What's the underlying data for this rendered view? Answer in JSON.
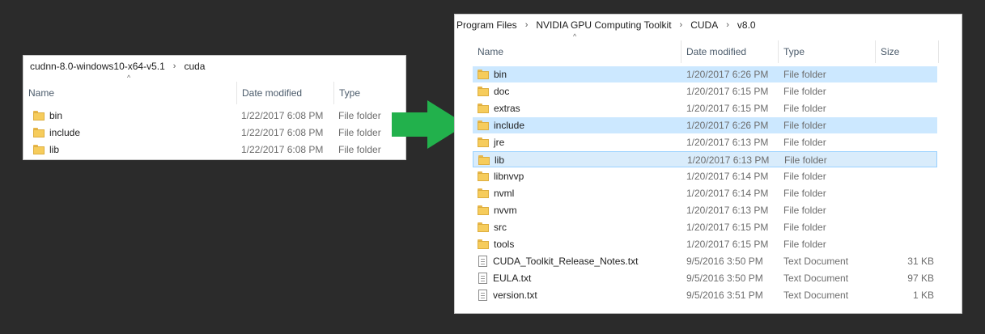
{
  "left_window": {
    "breadcrumb": [
      "cudnn-8.0-windows10-x64-v5.1",
      "cuda"
    ],
    "columns": {
      "name": "Name",
      "date": "Date modified",
      "type": "Type"
    },
    "rows": [
      {
        "name": "bin",
        "date": "1/22/2017 6:08 PM",
        "type": "File folder",
        "icon": "folder-icon"
      },
      {
        "name": "include",
        "date": "1/22/2017 6:08 PM",
        "type": "File folder",
        "icon": "folder-icon"
      },
      {
        "name": "lib",
        "date": "1/22/2017 6:08 PM",
        "type": "File folder",
        "icon": "folder-icon"
      }
    ]
  },
  "arrow": {
    "color": "#22b14c",
    "icon": "right-arrow-icon"
  },
  "right_window": {
    "breadcrumb": [
      "Program Files",
      "NVIDIA GPU Computing Toolkit",
      "CUDA",
      "v8.0"
    ],
    "columns": {
      "name": "Name",
      "date": "Date modified",
      "type": "Type",
      "size": "Size"
    },
    "rows": [
      {
        "name": "bin",
        "date": "1/20/2017 6:26 PM",
        "type": "File folder",
        "size": "",
        "icon": "folder-icon",
        "state": "selected"
      },
      {
        "name": "doc",
        "date": "1/20/2017 6:15 PM",
        "type": "File folder",
        "size": "",
        "icon": "folder-icon",
        "state": ""
      },
      {
        "name": "extras",
        "date": "1/20/2017 6:15 PM",
        "type": "File folder",
        "size": "",
        "icon": "folder-icon",
        "state": ""
      },
      {
        "name": "include",
        "date": "1/20/2017 6:26 PM",
        "type": "File folder",
        "size": "",
        "icon": "folder-icon",
        "state": "selected"
      },
      {
        "name": "jre",
        "date": "1/20/2017 6:13 PM",
        "type": "File folder",
        "size": "",
        "icon": "folder-icon",
        "state": ""
      },
      {
        "name": "lib",
        "date": "1/20/2017 6:13 PM",
        "type": "File folder",
        "size": "",
        "icon": "folder-icon",
        "state": "focused"
      },
      {
        "name": "libnvvp",
        "date": "1/20/2017 6:14 PM",
        "type": "File folder",
        "size": "",
        "icon": "folder-icon",
        "state": ""
      },
      {
        "name": "nvml",
        "date": "1/20/2017 6:14 PM",
        "type": "File folder",
        "size": "",
        "icon": "folder-icon",
        "state": ""
      },
      {
        "name": "nvvm",
        "date": "1/20/2017 6:13 PM",
        "type": "File folder",
        "size": "",
        "icon": "folder-icon",
        "state": ""
      },
      {
        "name": "src",
        "date": "1/20/2017 6:15 PM",
        "type": "File folder",
        "size": "",
        "icon": "folder-icon",
        "state": ""
      },
      {
        "name": "tools",
        "date": "1/20/2017 6:15 PM",
        "type": "File folder",
        "size": "",
        "icon": "folder-icon",
        "state": ""
      },
      {
        "name": "CUDA_Toolkit_Release_Notes.txt",
        "date": "9/5/2016 3:50 PM",
        "type": "Text Document",
        "size": "31 KB",
        "icon": "text-document-icon",
        "state": ""
      },
      {
        "name": "EULA.txt",
        "date": "9/5/2016 3:50 PM",
        "type": "Text Document",
        "size": "97 KB",
        "icon": "text-document-icon",
        "state": ""
      },
      {
        "name": "version.txt",
        "date": "9/5/2016 3:51 PM",
        "type": "Text Document",
        "size": "1 KB",
        "icon": "text-document-icon",
        "state": ""
      }
    ]
  }
}
